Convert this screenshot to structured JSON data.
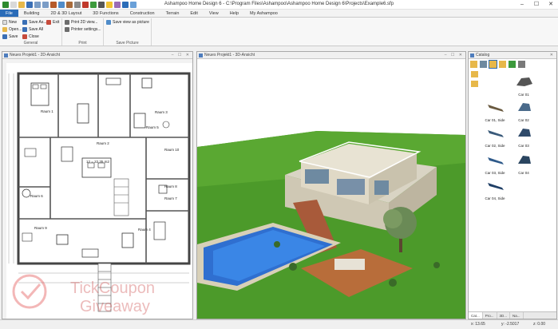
{
  "window": {
    "title": "Ashampoo Home Design 6 - C:\\Program Files\\Ashampoo\\Ashampoo Home Design 6\\Projects\\Example6.sfp"
  },
  "menu": [
    "File",
    "Building",
    "2D & 3D Layout",
    "3D Functions",
    "Construction",
    "Terrain",
    "Edit",
    "View",
    "Help",
    "My Ashampoo"
  ],
  "ribbon": {
    "new": "New",
    "open": "Open...",
    "save": "Save",
    "save_as": "Save As...",
    "save_all": "Save All",
    "close": "Close",
    "exit": "Exit",
    "general": "General",
    "print_2d": "Print 2D view...",
    "printer_settings": "Printer settings...",
    "print": "Print",
    "save_view": "Save view as picture",
    "save_picture": "Save Picture"
  },
  "plan": {
    "title": "Neues Projekt1 - 2D-Ansicht",
    "rooms": [
      "Raum 1",
      "Raum 2",
      "Raum 3",
      "Raum 4",
      "Raum 5",
      "Raum 6",
      "Raum 7",
      "Raum 8",
      "Raum 9",
      "Raum 10"
    ],
    "area": "12 = 22,35 m2"
  },
  "view3d": {
    "title": "Neues Projekt1 - 3D-Ansicht"
  },
  "catalog": {
    "title": "Catalog",
    "items": [
      "Car 01",
      "Car 01, Side",
      "Car 02",
      "Car 02, Side",
      "Car 03",
      "Car 03, Side",
      "Car 04",
      "Car 04, Side"
    ],
    "tabs": [
      "Cat...",
      "Pro...",
      "3D...",
      "Na..."
    ]
  },
  "status": {
    "x": "x: 13.65",
    "y": "y: -2.5017",
    "z": "z: 0.00"
  },
  "watermark": [
    "TickCoupon",
    "Giveaway"
  ]
}
